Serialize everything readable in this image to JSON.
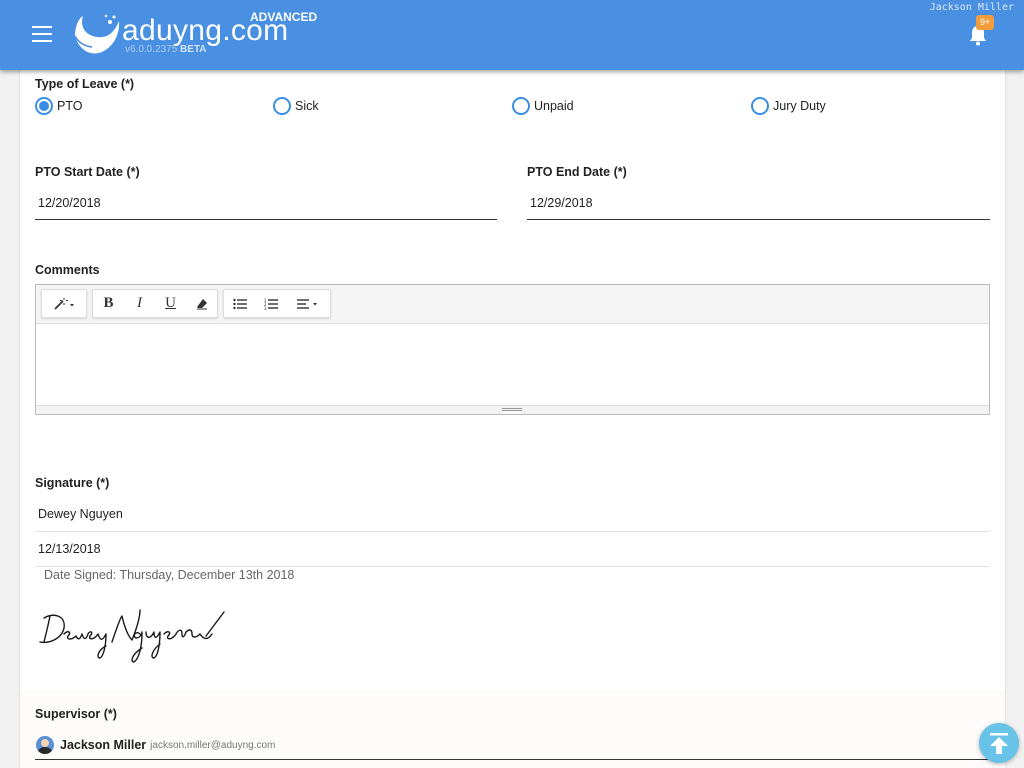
{
  "header": {
    "brand": "aduyng.com",
    "edition": "ADVANCED",
    "version": "v6.0.0.2375",
    "version_tag": "BETA",
    "user_name": "Jackson Miller",
    "notification_badge": "9+",
    "bar_color": "#4a90e2"
  },
  "form": {
    "leave_type": {
      "label": "Type of Leave (*)",
      "options": [
        "PTO",
        "Sick",
        "Unpaid",
        "Jury Duty"
      ],
      "selected": "PTO"
    },
    "start_date": {
      "label": "PTO Start Date (*)",
      "value": "12/20/2018"
    },
    "end_date": {
      "label": "PTO End Date (*)",
      "value": "12/29/2018"
    },
    "comments": {
      "label": "Comments",
      "toolbar": [
        "magic-wand-style",
        "bold",
        "italic",
        "underline",
        "eraser",
        "unordered-list",
        "ordered-list",
        "paragraph-align"
      ],
      "value": ""
    },
    "signature": {
      "label": "Signature (*)",
      "name": "Dewey Nguyen",
      "date": "12/13/2018",
      "date_signed": "Date Signed: Thursday, December 13th 2018",
      "handwritten": "Dewey Nguyen"
    },
    "supervisor": {
      "label": "Supervisor (*)",
      "name": "Jackson Miller",
      "email": "jackson.miller@aduyng.com"
    }
  },
  "accent_color": "#3a8ee6"
}
